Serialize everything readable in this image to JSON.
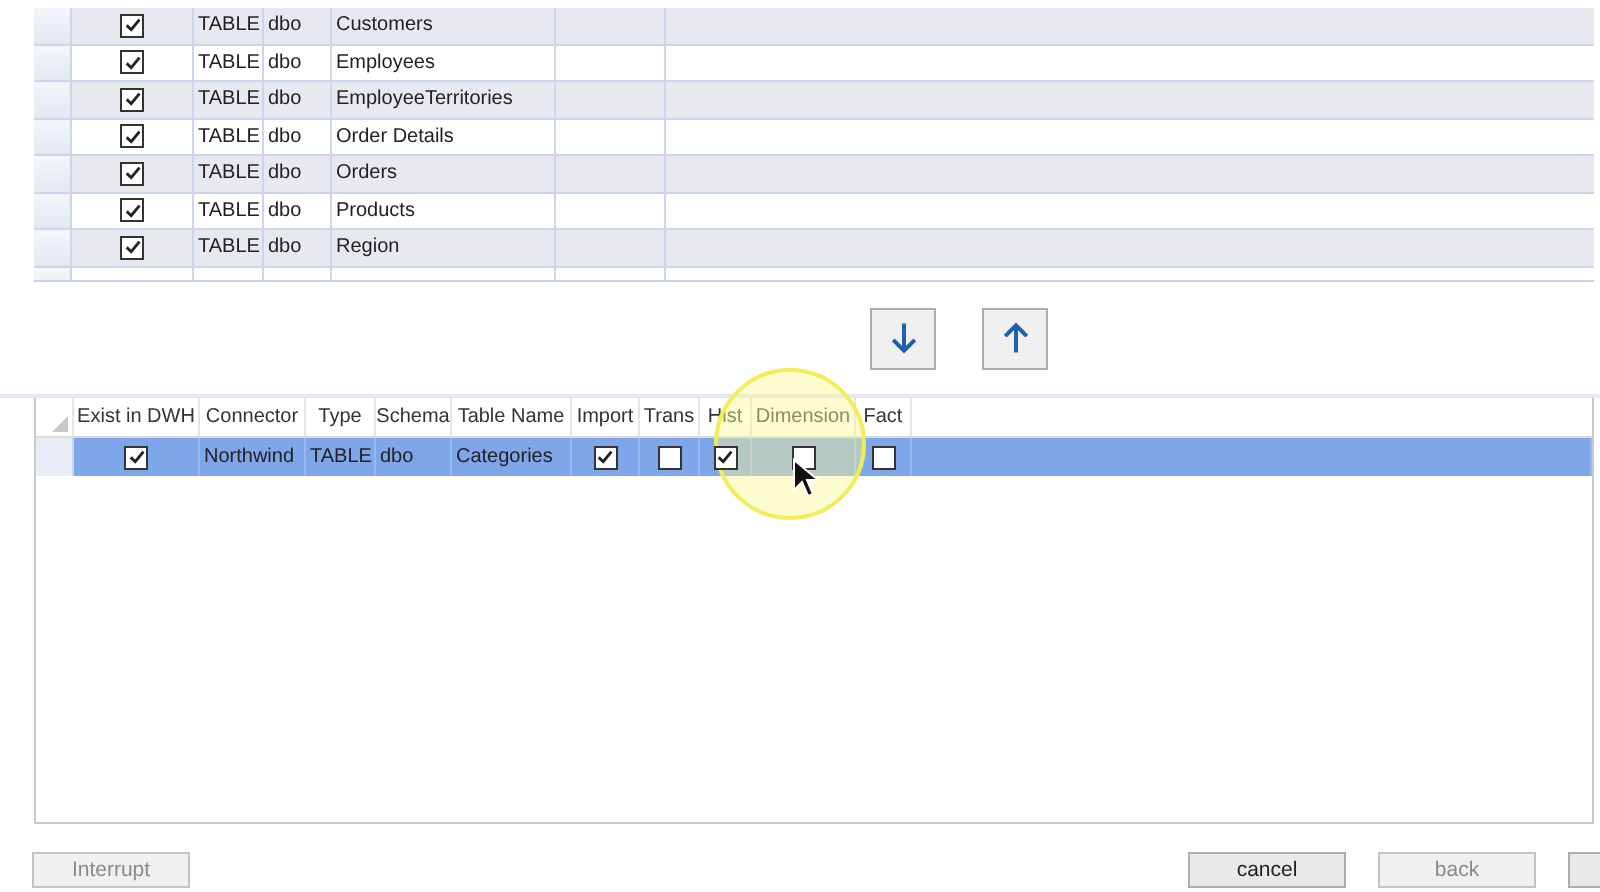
{
  "source_table": {
    "rows": [
      {
        "included": true,
        "type": "TABLE",
        "schema": "dbo",
        "name": "Customers"
      },
      {
        "included": true,
        "type": "TABLE",
        "schema": "dbo",
        "name": "Employees"
      },
      {
        "included": true,
        "type": "TABLE",
        "schema": "dbo",
        "name": "EmployeeTerritories"
      },
      {
        "included": true,
        "type": "TABLE",
        "schema": "dbo",
        "name": "Order Details"
      },
      {
        "included": true,
        "type": "TABLE",
        "schema": "dbo",
        "name": "Orders"
      },
      {
        "included": true,
        "type": "TABLE",
        "schema": "dbo",
        "name": "Products"
      },
      {
        "included": true,
        "type": "TABLE",
        "schema": "dbo",
        "name": "Region"
      }
    ]
  },
  "selected_table": {
    "columns": [
      "Exist in DWH",
      "Connector",
      "Type",
      "Schema",
      "Table Name",
      "Import",
      "Trans",
      "Hist",
      "Dimension",
      "Fact"
    ],
    "rows": [
      {
        "selected": true,
        "exist_in_dwh": true,
        "connector": "Northwind",
        "type": "TABLE",
        "schema": "dbo",
        "table_name": "Categories",
        "import": true,
        "trans": false,
        "hist": true,
        "dimension": false,
        "fact": false
      }
    ]
  },
  "buttons": [
    {
      "label": "Interrupt",
      "disabled": true
    },
    {
      "label": "cancel",
      "disabled": false
    },
    {
      "label": "back",
      "disabled": true
    }
  ]
}
